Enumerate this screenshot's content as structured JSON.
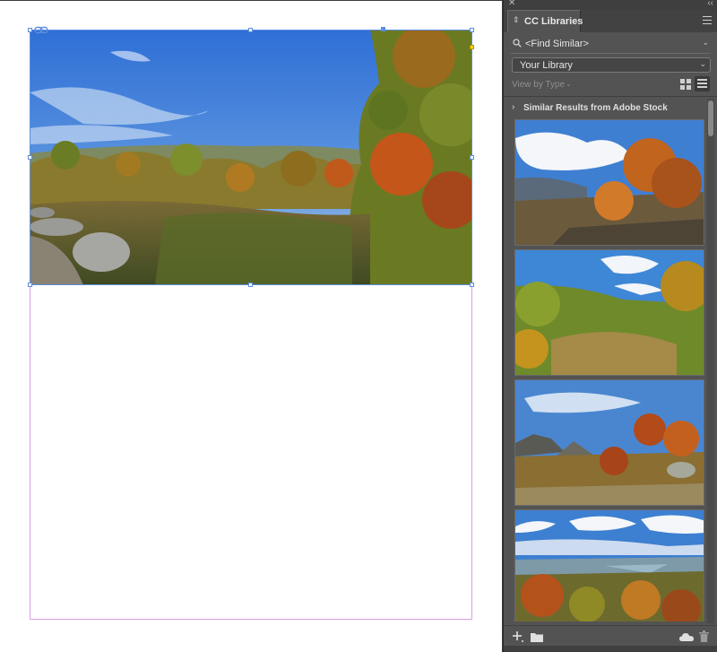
{
  "panel": {
    "title": "CC Libraries",
    "find_similar_label": "<Find Similar>",
    "library_selected": "Your Library",
    "view_by_label": "View by Type",
    "section_title": "Similar Results from Adobe Stock"
  },
  "icons": {
    "close": "close-icon",
    "collapse": "double-chevron-icon",
    "panel_menu": "hamburger-menu-icon",
    "search": "search-icon",
    "grid_view": "grid-view-icon",
    "list_view": "list-view-icon",
    "add": "add-icon",
    "folder": "folder-icon",
    "cloud": "cloud-icon",
    "trash": "trash-icon",
    "link": "link-icon"
  },
  "colors": {
    "panel_bg": "#535353",
    "frame_selection": "#5b8ede",
    "margin_guide": "#d99ee6"
  },
  "results": [
    {
      "alt": "autumn-hillside-thumbnail"
    },
    {
      "alt": "valley-meadow-thumbnail"
    },
    {
      "alt": "rocky-ridge-thumbnail"
    },
    {
      "alt": "river-valley-thumbnail"
    }
  ]
}
